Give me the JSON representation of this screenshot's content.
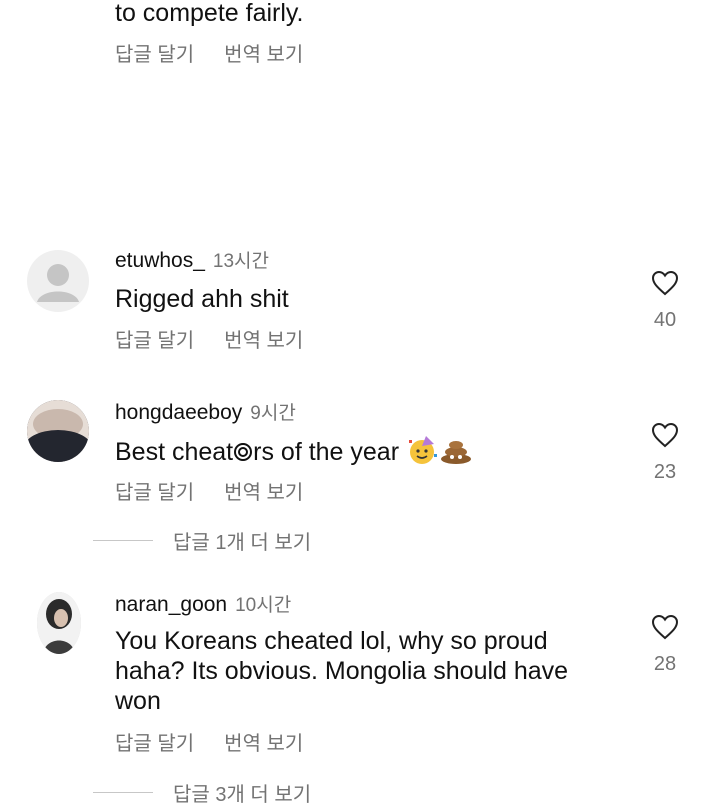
{
  "top_comment": {
    "text_tail": "to compete fairly.",
    "reply_label": "답글 달기",
    "translate_label": "번역 보기"
  },
  "comments": [
    {
      "username": "etuwhos_",
      "time": "13시간",
      "text": "Rigged ahh shit",
      "reply_label": "답글 달기",
      "translate_label": "번역 보기",
      "likes": "40",
      "avatar": "default-avatar-icon"
    },
    {
      "username": "hongdaeeboy",
      "time": "9시간",
      "text_a": "Best cheat",
      "text_b": "rs of the year",
      "reply_label": "답글 달기",
      "translate_label": "번역 보기",
      "likes": "23",
      "more_replies": "답글 1개 더 보기",
      "emojis": [
        "e-glyph-icon",
        "party-face-icon",
        "poop-icon"
      ]
    },
    {
      "username": "naran_goon",
      "time": "10시간",
      "text_line1": "You Koreans cheated lol, why so proud",
      "text_line2": "haha? Its obvious. Mongolia should have",
      "text_line3": "won",
      "reply_label": "답글 달기",
      "translate_label": "번역 보기",
      "likes": "28",
      "more_replies": "답글 3개 더 보기"
    }
  ],
  "colors": {
    "text": "#111111",
    "muted": "#737373",
    "divider": "#c7c7c7",
    "default_avatar_bg": "#efefef",
    "default_avatar_fg": "#c5c5c5"
  }
}
